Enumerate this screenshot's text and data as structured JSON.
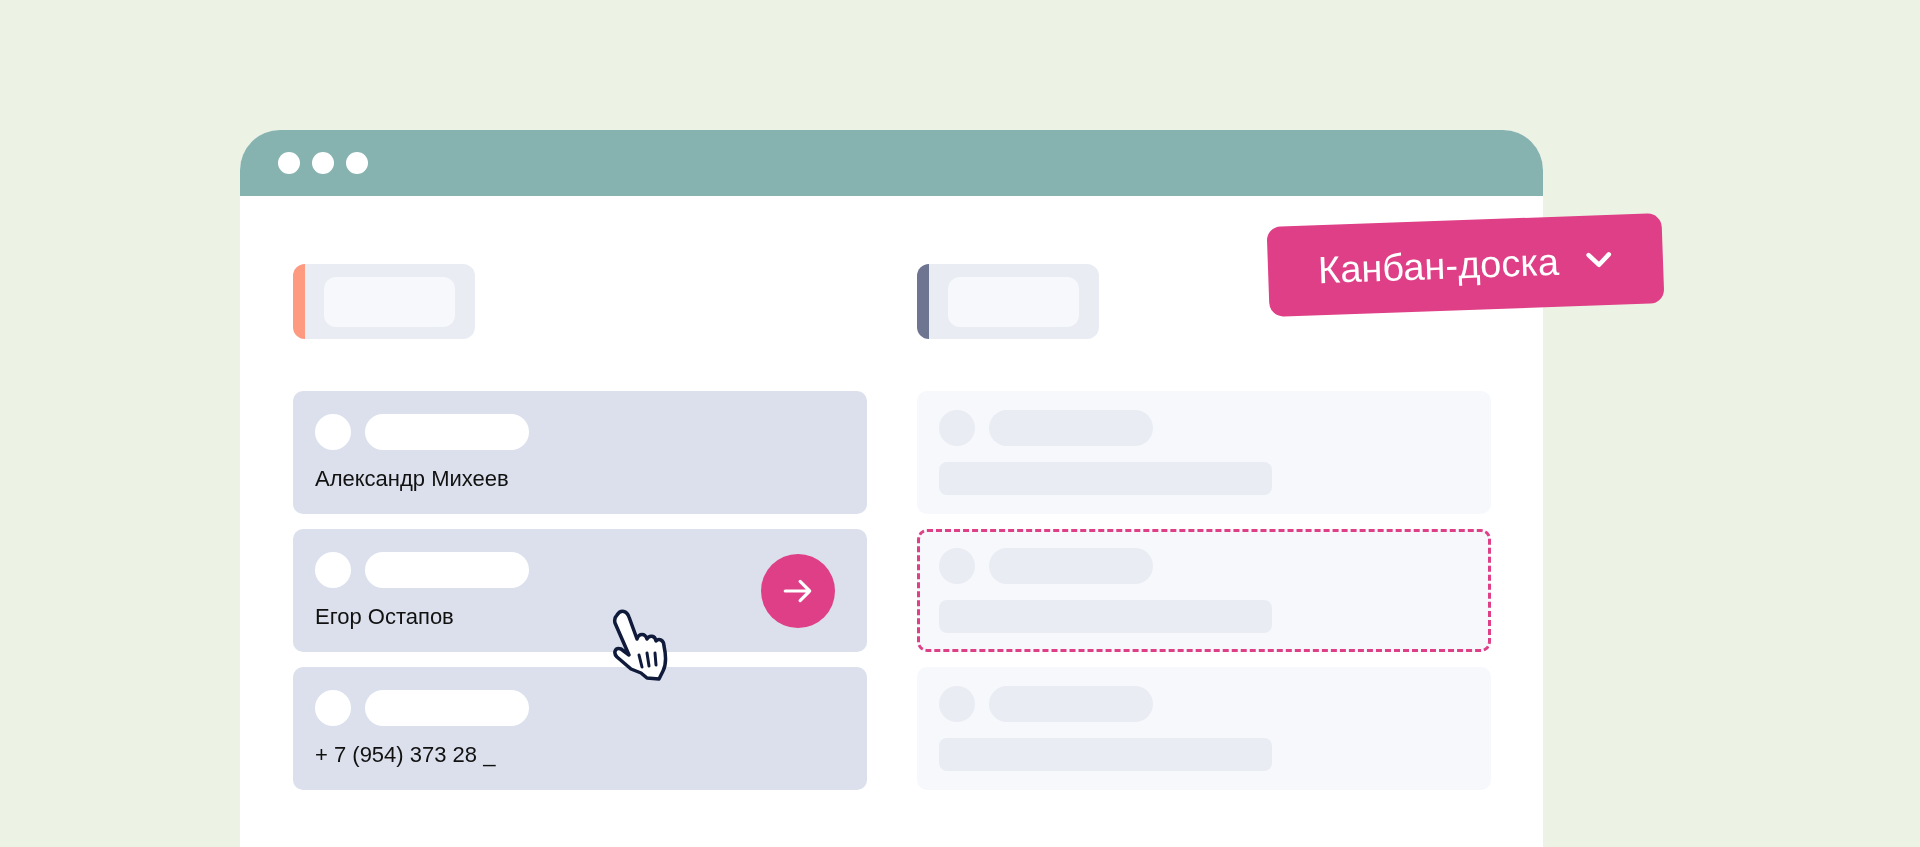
{
  "view_selector": {
    "label": "Канбан-доска"
  },
  "columns": [
    {
      "color": "#fe9a80",
      "cards": [
        {
          "kind": "filled",
          "text": "Александр Михеев",
          "action": false
        },
        {
          "kind": "filled",
          "text": "Егор Остапов",
          "action": true
        },
        {
          "kind": "filled",
          "text": "+ 7 (954) 373 28 _",
          "action": false
        }
      ]
    },
    {
      "color": "#6e7590",
      "cards": [
        {
          "kind": "placeholder",
          "action": false
        },
        {
          "kind": "drop-target",
          "action": false
        },
        {
          "kind": "placeholder",
          "action": false
        }
      ]
    }
  ]
}
